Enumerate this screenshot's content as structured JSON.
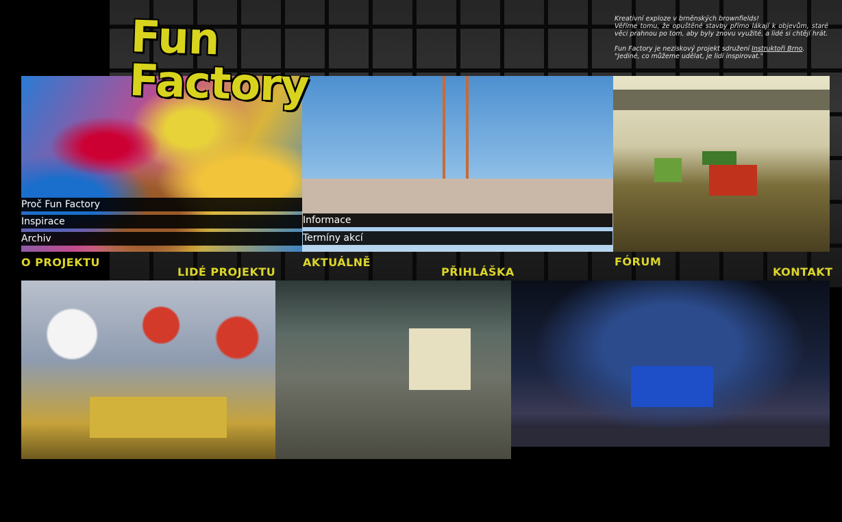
{
  "header": {
    "logo_line1": "Fun Factory",
    "intro_lines": [
      "Kreativní exploze v brněnských brownfields!",
      "Věříme tomu, že opuštěné stavby přímo lákají k objevům, staré věci prahnou po tom, aby byly znovu využité, a lidé si chtějí hrát."
    ],
    "intro_para2_prefix": "Fun Factory je neziskový projekt sdružení ",
    "intro_link": "Instruktoři Brno",
    "intro_para2_suffix": ".",
    "quote": "\"Jediné, co můžeme udělat, je lidi inspirovat.\""
  },
  "nav": {
    "o_projektu": {
      "title": "O PROJEKTU",
      "items": [
        "Proč Fun Factory",
        "Inspirace",
        "Archiv"
      ]
    },
    "lide_projektu": {
      "title": "LIDÉ PROJEKTU"
    },
    "aktualne": {
      "title": "AKTUÁLNĚ",
      "items": [
        "Informace",
        "Termíny akcí"
      ]
    },
    "prihlaska": {
      "title": "PŘIHLÁŠKA"
    },
    "forum": {
      "title": "FÓRUM"
    },
    "kontakt": {
      "title": "KONTAKT"
    }
  },
  "colors": {
    "accent": "#dcd62a",
    "background": "#000000"
  }
}
